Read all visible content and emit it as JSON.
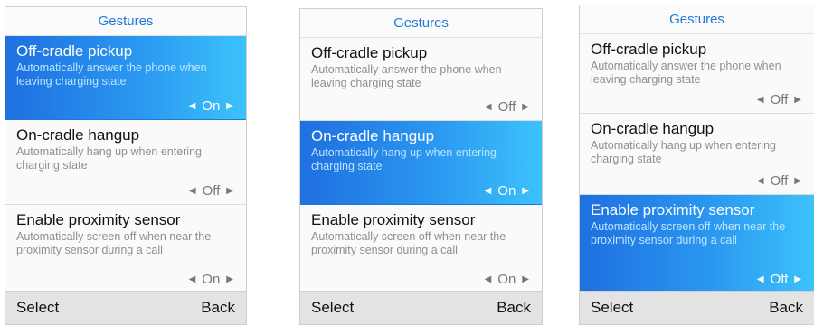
{
  "screens": [
    {
      "title": "Gestures",
      "items": [
        {
          "title": "Off-cradle pickup",
          "desc": "Automatically answer the phone when leaving charging state",
          "value": "On",
          "selected": true
        },
        {
          "title": "On-cradle hangup",
          "desc": "Automatically hang up when entering charging state",
          "value": "Off",
          "selected": false
        },
        {
          "title": "Enable proximity sensor",
          "desc": "Automatically screen off when near the  proximity sensor during a call",
          "value": "On",
          "selected": false
        }
      ],
      "softkeys": {
        "left": "Select",
        "right": "Back"
      }
    },
    {
      "title": "Gestures",
      "items": [
        {
          "title": "Off-cradle pickup",
          "desc": "Automatically answer the phone when leaving charging state",
          "value": "Off",
          "selected": false
        },
        {
          "title": "On-cradle hangup",
          "desc": "Automatically hang up when entering charging state",
          "value": "On",
          "selected": true
        },
        {
          "title": "Enable proximity sensor",
          "desc": "Automatically screen off when near the  proximity sensor during a call",
          "value": "On",
          "selected": false
        }
      ],
      "softkeys": {
        "left": "Select",
        "right": "Back"
      }
    },
    {
      "title": "Gestures",
      "items": [
        {
          "title": "Off-cradle pickup",
          "desc": "Automatically answer the phone when leaving charging state",
          "value": "Off",
          "selected": false
        },
        {
          "title": "On-cradle hangup",
          "desc": "Automatically hang up when entering charging state",
          "value": "Off",
          "selected": false
        },
        {
          "title": "Enable proximity sensor",
          "desc": "Automatically screen off when near the  proximity sensor during a call",
          "value": "Off",
          "selected": true
        }
      ],
      "softkeys": {
        "left": "Select",
        "right": "Back"
      }
    }
  ],
  "icons": {
    "prev": "left-triangle-icon",
    "next": "right-triangle-icon"
  }
}
